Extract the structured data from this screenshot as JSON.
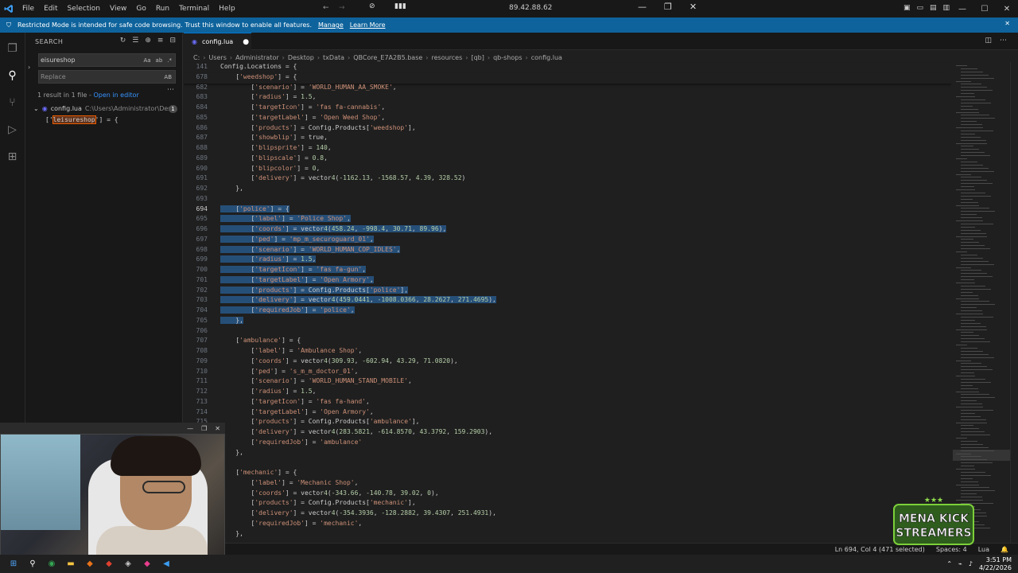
{
  "titlebar": {
    "menu": [
      "File",
      "Edit",
      "Selection",
      "View",
      "Go",
      "Run",
      "Terminal",
      "Help"
    ],
    "remote_ip": "89.42.88.62"
  },
  "banner": {
    "text": "Restricted Mode is intended for safe code browsing. Trust this window to enable all features.",
    "manage": "Manage",
    "learn_more": "Learn More"
  },
  "sidebar": {
    "title": "SEARCH",
    "search_value": "eisureshop",
    "search_opts": [
      "Aa",
      "ab",
      ".*"
    ],
    "replace_placeholder": "Replace",
    "replace_opt": "AB",
    "result_summary": "1 result in 1 file - ",
    "open_in_editor": "Open in editor",
    "file_name": "config.lua",
    "file_path": "C:\\Users\\Administrator\\Des...",
    "file_count": "1",
    "match_prefix": "['",
    "match_hl": "leisureshop",
    "match_suffix": "'] = {"
  },
  "editor": {
    "tab_name": "config.lua",
    "breadcrumb": [
      "C:",
      "Users",
      "Administrator",
      "Desktop",
      "txData",
      "QBCore_E7A2B5.base",
      "resources",
      "[qb]",
      "qb-shops",
      "config.lua"
    ]
  },
  "code": [
    {
      "n": "141",
      "t": "Config.Locations = {",
      "sticky": true
    },
    {
      "n": "678",
      "t": "    ['weedshop'] = {",
      "sticky": true
    },
    {
      "n": "682",
      "t": "        ['scenario'] = 'WORLD_HUMAN_AA_SMOKE',"
    },
    {
      "n": "683",
      "t": "        ['radius'] = 1.5,"
    },
    {
      "n": "684",
      "t": "        ['targetIcon'] = 'fas fa-cannabis',"
    },
    {
      "n": "685",
      "t": "        ['targetLabel'] = 'Open Weed Shop',"
    },
    {
      "n": "686",
      "t": "        ['products'] = Config.Products['weedshop'],"
    },
    {
      "n": "687",
      "t": "        ['showblip'] = true,"
    },
    {
      "n": "688",
      "t": "        ['blipsprite'] = 140,"
    },
    {
      "n": "689",
      "t": "        ['blipscale'] = 0.8,"
    },
    {
      "n": "690",
      "t": "        ['blipcolor'] = 0,"
    },
    {
      "n": "691",
      "t": "        ['delivery'] = vector4(-1162.13, -1568.57, 4.39, 328.52)"
    },
    {
      "n": "692",
      "t": "    },"
    },
    {
      "n": "693",
      "t": ""
    },
    {
      "n": "694",
      "t": "    ['police'] = {",
      "sel": true,
      "cur": true
    },
    {
      "n": "695",
      "t": "        ['label'] = 'Police Shop',",
      "sel": true
    },
    {
      "n": "696",
      "t": "        ['coords'] = vector4(458.24, -998.4, 30.71, 89.96),",
      "sel": true
    },
    {
      "n": "697",
      "t": "        ['ped'] = 'mp_m_securoguard_01',",
      "sel": true
    },
    {
      "n": "698",
      "t": "        ['scenario'] = 'WORLD_HUMAN_COP_IDLES',",
      "sel": true
    },
    {
      "n": "699",
      "t": "        ['radius'] = 1.5,",
      "sel": true
    },
    {
      "n": "700",
      "t": "        ['targetIcon'] = 'fas fa-gun',",
      "sel": true
    },
    {
      "n": "701",
      "t": "        ['targetLabel'] = 'Open Armory',",
      "sel": true
    },
    {
      "n": "702",
      "t": "        ['products'] = Config.Products['police'],",
      "sel": true
    },
    {
      "n": "703",
      "t": "        ['delivery'] = vector4(459.0441, -1008.0366, 28.2627, 271.4695),",
      "sel": true
    },
    {
      "n": "704",
      "t": "        ['requiredJob'] = 'police',",
      "sel": true
    },
    {
      "n": "705",
      "t": "    },",
      "sel": true
    },
    {
      "n": "706",
      "t": ""
    },
    {
      "n": "707",
      "t": "    ['ambulance'] = {"
    },
    {
      "n": "708",
      "t": "        ['label'] = 'Ambulance Shop',"
    },
    {
      "n": "709",
      "t": "        ['coords'] = vector4(309.93, -602.94, 43.29, 71.0820),"
    },
    {
      "n": "710",
      "t": "        ['ped'] = 's_m_m_doctor_01',"
    },
    {
      "n": "711",
      "t": "        ['scenario'] = 'WORLD_HUMAN_STAND_MOBILE',"
    },
    {
      "n": "712",
      "t": "        ['radius'] = 1.5,"
    },
    {
      "n": "713",
      "t": "        ['targetIcon'] = 'fas fa-hand',"
    },
    {
      "n": "714",
      "t": "        ['targetLabel'] = 'Open Armory',"
    },
    {
      "n": "715",
      "t": "        ['products'] = Config.Products['ambulance'],"
    },
    {
      "n": "716",
      "t": "        ['delivery'] = vector4(283.5821, -614.8570, 43.3792, 159.2903),"
    },
    {
      "n": "717",
      "t": "        ['requiredJob'] = 'ambulance'"
    },
    {
      "n": "718",
      "t": "    },"
    },
    {
      "n": "719",
      "t": ""
    },
    {
      "n": "720",
      "t": "    ['mechanic'] = {"
    },
    {
      "n": "721",
      "t": "        ['label'] = 'Mechanic Shop',"
    },
    {
      "n": "722",
      "t": "        ['coords'] = vector4(-343.66, -140.78, 39.02, 0),"
    },
    {
      "n": "723",
      "t": "        ['products'] = Config.Products['mechanic'],"
    },
    {
      "n": "724",
      "t": "        ['delivery'] = vector4(-354.3936, -128.2882, 39.4307, 251.4931),"
    },
    {
      "n": "725",
      "t": "        ['requiredJob'] = 'mechanic',"
    },
    {
      "n": "726",
      "t": "    },"
    }
  ],
  "status": {
    "position": "Ln 694, Col 4 (471 selected)",
    "spaces": "Spaces: 4",
    "language": "Lua"
  },
  "taskbar": {
    "time": "3:51 PM",
    "date": "4/22/2026"
  },
  "watermark": {
    "line1": "MENA KICK",
    "line2": "STREAMERS"
  },
  "colors": {
    "keyword": "#cccccc",
    "string": "#ce9178",
    "number": "#b5cea8",
    "function": "#dcdcaa",
    "selection": "#264f78",
    "accent": "#0078d4",
    "banner": "#0e639c"
  }
}
